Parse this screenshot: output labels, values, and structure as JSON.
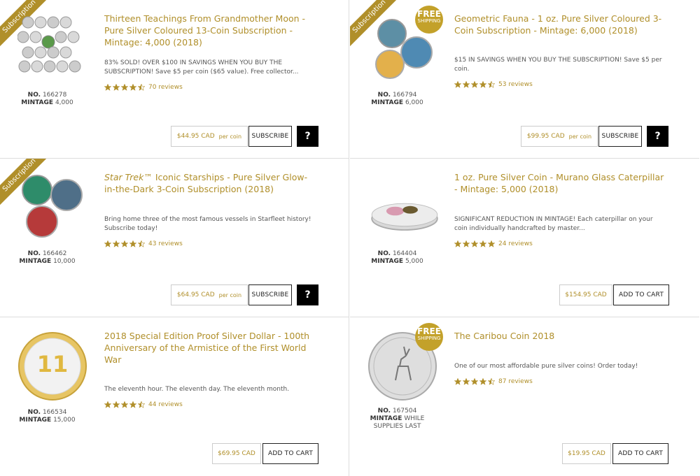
{
  "colors": {
    "accent": "#b08f2a",
    "badge": "#c3a12a",
    "border": "#dddddd",
    "text": "#555555"
  },
  "labels": {
    "subscription": "Subscription",
    "free_top": "FREE",
    "free_bottom": "SHIPPING",
    "no_prefix": "NO.",
    "mintage_prefix": "MINTAGE",
    "per_coin": "per coin",
    "subscribe": "SUBSCRIBE",
    "add_to_cart": "ADD TO CART",
    "question": "?"
  },
  "products": [
    {
      "title": "Thirteen Teachings From Grandmother Moon - Pure Silver Coloured 13-Coin Subscription - Mintage: 4,000 (2018)",
      "description": "83% SOLD! OVER $100 IN SAVINGS WHEN YOU BUY THE SUBSCRIPTION! Save $5 per coin ($65 value). Free collector...",
      "rating": 4.5,
      "reviews": "70 reviews",
      "number": "166278",
      "mintage": "4,000",
      "price": "$44.95 CAD",
      "has_per_coin": true,
      "action": "SUBSCRIBE",
      "has_help": true,
      "subscription_ribbon": true,
      "free_shipping": false
    },
    {
      "title": "Geometric Fauna - 1 oz. Pure Silver Coloured 3-Coin Subscription - Mintage: 6,000 (2018)",
      "description": "$15 IN SAVINGS WHEN YOU BUY THE SUBSCRIPTION! Save $5 per coin.",
      "rating": 4.5,
      "reviews": "53 reviews",
      "number": "166794",
      "mintage": "6,000",
      "price": "$99.95 CAD",
      "has_per_coin": true,
      "action": "SUBSCRIBE",
      "has_help": true,
      "subscription_ribbon": true,
      "free_shipping": true
    },
    {
      "title_italic": "Star Trek",
      "title_rest": "™ Iconic Starships - Pure Silver Glow-in-the-Dark 3-Coin Subscription (2018)",
      "description": "Bring home three of the most famous vessels in Starfleet history! Subscribe today!",
      "rating": 4.5,
      "reviews": "43 reviews",
      "number": "166462",
      "mintage": "10,000",
      "price": "$64.95 CAD",
      "has_per_coin": true,
      "action": "SUBSCRIBE",
      "has_help": true,
      "subscription_ribbon": true,
      "free_shipping": false
    },
    {
      "title": "1 oz. Pure Silver Coin - Murano Glass Caterpillar - Mintage: 5,000 (2018)",
      "description": "SIGNIFICANT REDUCTION IN MINTAGE! Each caterpillar on your coin individually handcrafted by master...",
      "rating": 5,
      "reviews": "24 reviews",
      "number": "164404",
      "mintage": "5,000",
      "price": "$154.95 CAD",
      "has_per_coin": false,
      "action": "ADD TO CART",
      "has_help": false,
      "subscription_ribbon": false,
      "free_shipping": false
    },
    {
      "title": "2018 Special Edition Proof Silver Dollar - 100th Anniversary of the Armistice of the First World War",
      "description": "The eleventh hour. The eleventh day. The eleventh month.",
      "rating": 4.5,
      "reviews": "44 reviews",
      "number": "166534",
      "mintage": "15,000",
      "price": "$69.95 CAD",
      "has_per_coin": false,
      "action": "ADD TO CART",
      "has_help": false,
      "subscription_ribbon": false,
      "free_shipping": false
    },
    {
      "title": "The Caribou Coin 2018",
      "description": "One of our most affordable pure silver coins! Order today!",
      "rating": 4.5,
      "reviews": "87 reviews",
      "number": "167504",
      "mintage": "WHILE SUPPLIES LAST",
      "price": "$19.95 CAD",
      "has_per_coin": false,
      "action": "ADD TO CART",
      "has_help": false,
      "subscription_ribbon": false,
      "free_shipping": true
    }
  ]
}
